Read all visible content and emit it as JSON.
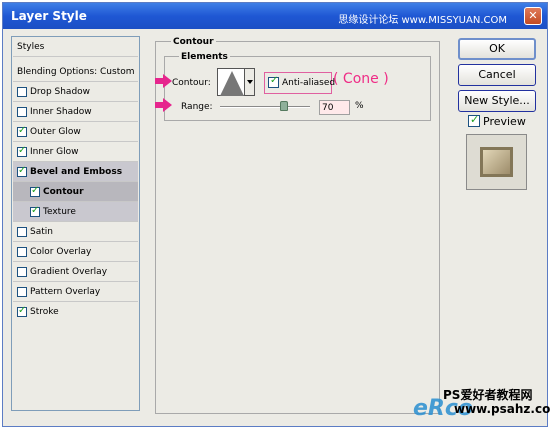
{
  "window": {
    "title": "Layer Style",
    "watermark_top": "思缘设计论坛 www.MISSYUAN.COM",
    "close_label": "✕"
  },
  "style_list": {
    "items": [
      {
        "label": "Styles",
        "checked": null
      },
      {
        "label": "Blending Options: Custom",
        "checked": null
      },
      {
        "label": "Drop Shadow",
        "checked": false
      },
      {
        "label": "Inner Shadow",
        "checked": false
      },
      {
        "label": "Outer Glow",
        "checked": true
      },
      {
        "label": "Inner Glow",
        "checked": true
      },
      {
        "label": "Bevel and Emboss",
        "checked": true
      },
      {
        "label": "Contour",
        "checked": true
      },
      {
        "label": "Texture",
        "checked": true
      },
      {
        "label": "Satin",
        "checked": false
      },
      {
        "label": "Color Overlay",
        "checked": false
      },
      {
        "label": "Gradient Overlay",
        "checked": false
      },
      {
        "label": "Pattern Overlay",
        "checked": false
      },
      {
        "label": "Stroke",
        "checked": true
      }
    ]
  },
  "panel": {
    "group_title": "Contour",
    "elements_title": "Elements",
    "contour_label": "Contour:",
    "anti_aliased_label": "Anti-aliased",
    "anti_aliased_checked": true,
    "cone_note": "( Cone )",
    "range_label": "Range:",
    "range_value": "70",
    "range_unit": "%"
  },
  "buttons": {
    "ok": "OK",
    "cancel": "Cancel",
    "new_style": "New Style..."
  },
  "preview": {
    "label": "Preview",
    "checked": true
  },
  "watermark": {
    "line1": "PS爱好者教程网",
    "line2": "www.psahz.com",
    "logo": "eRco"
  },
  "colors": {
    "accent_arrow": "#e6258d",
    "cone_note": "#ef2c86",
    "titlebar": "#1f57d4"
  }
}
